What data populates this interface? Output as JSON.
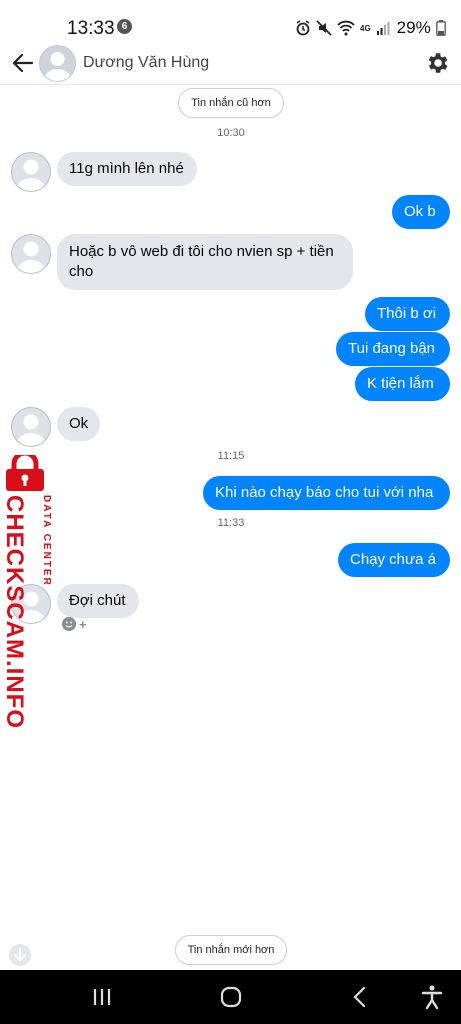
{
  "status_bar": {
    "time": "13:33",
    "notification_count": "6",
    "battery": "29%",
    "network": "4G"
  },
  "header": {
    "contact_name": "Dương Văn Hùng"
  },
  "older_messages_label": "Tin nhắn cũ hơn",
  "newer_messages_label": "Tin nhắn mới hơn",
  "timestamps": [
    "10:30",
    "11:15",
    "11:33"
  ],
  "messages": [
    {
      "side": "in",
      "text": "11g mình lên nhé"
    },
    {
      "side": "out",
      "text": "Ok b"
    },
    {
      "side": "in",
      "text": "Hoặc b vô web đi tôi cho nvien sp + tiền cho"
    },
    {
      "side": "out",
      "text": "Thôi b ơi"
    },
    {
      "side": "out",
      "text": "Tui đang bận"
    },
    {
      "side": "out",
      "text": "K tiện lắm"
    },
    {
      "side": "in",
      "text": "Ok"
    },
    {
      "side": "out",
      "text": "Khi nào chạy báo cho tui với nha"
    },
    {
      "side": "out",
      "text": "Chạy chưa á"
    },
    {
      "side": "in",
      "text": "Đợi chút"
    }
  ],
  "watermark": {
    "main": "CHECKSCAM.INFO",
    "sub": "DATA CENTER"
  },
  "colors": {
    "outgoing_bubble": "#0084ff",
    "incoming_bubble": "#e4e6eb",
    "watermark": "#d80f1b"
  }
}
